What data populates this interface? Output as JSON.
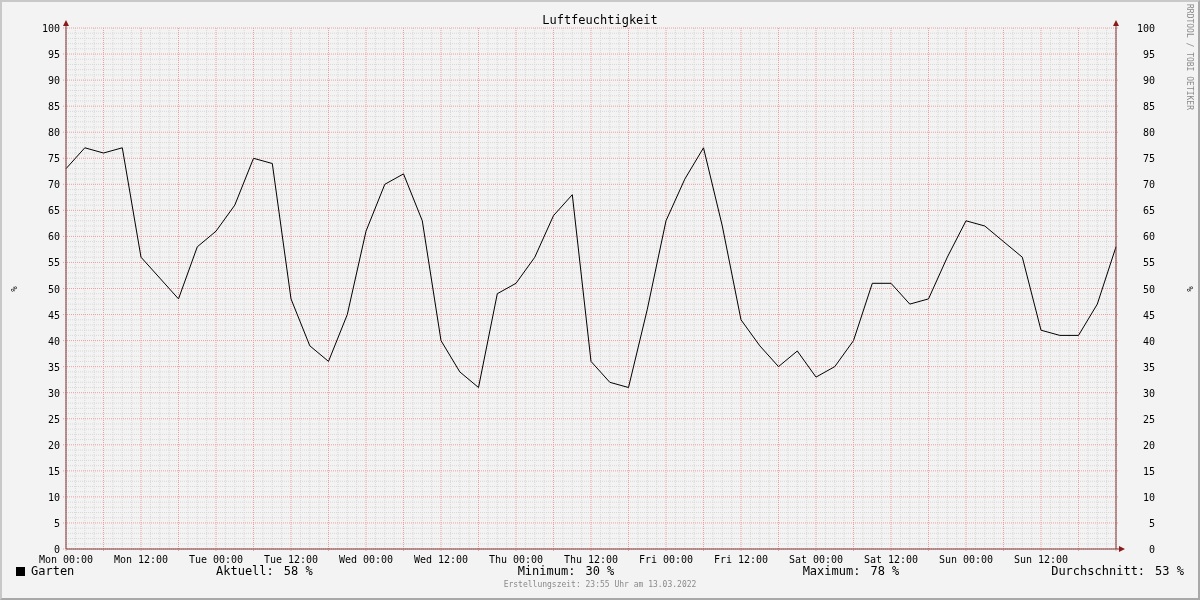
{
  "chart_data": {
    "type": "line",
    "title": "Luftfeuchtigkeit",
    "ylabel": "%",
    "categories": [
      "Mon 00:00",
      null,
      null,
      null,
      "Mon 12:00",
      null,
      null,
      null,
      "Tue 00:00",
      null,
      null,
      null,
      "Tue 12:00",
      null,
      null,
      null,
      "Wed 00:00",
      null,
      null,
      null,
      "Wed 12:00",
      null,
      null,
      null,
      "Thu 00:00",
      null,
      null,
      null,
      "Thu 12:00",
      null,
      null,
      null,
      "Fri 00:00",
      null,
      null,
      null,
      "Fri 12:00",
      null,
      null,
      null,
      "Sat 00:00",
      null,
      null,
      null,
      "Sat 12:00",
      null,
      null,
      null,
      "Sun 00:00",
      null,
      null,
      null,
      "Sun 12:00",
      null,
      null,
      null,
      null
    ],
    "series": [
      {
        "name": "Garten",
        "color": "#000000",
        "values": [
          73,
          77,
          76,
          77,
          56,
          52,
          48,
          58,
          61,
          66,
          75,
          74,
          48,
          39,
          36,
          45,
          61,
          70,
          72,
          63,
          40,
          34,
          31,
          49,
          51,
          56,
          64,
          68,
          36,
          32,
          31,
          46,
          63,
          71,
          77,
          62,
          44,
          39,
          35,
          38,
          33,
          35,
          40,
          51,
          51,
          47,
          48,
          56,
          63,
          62,
          59,
          56,
          42,
          41,
          41,
          47,
          58
        ]
      }
    ],
    "ylim": [
      0,
      100
    ],
    "grid": true,
    "yticks": [
      0,
      5,
      10,
      15,
      20,
      25,
      30,
      35,
      40,
      45,
      50,
      55,
      60,
      65,
      70,
      75,
      80,
      85,
      90,
      95,
      100
    ]
  },
  "right_axis": {
    "ylabel": "%",
    "labels": [
      "100",
      "95",
      "90",
      "85",
      "80",
      "75",
      "70",
      "65",
      "60",
      "55",
      "50",
      "45",
      "40",
      "35",
      "30",
      "25",
      "20",
      "15",
      "10",
      "5",
      "0"
    ]
  },
  "watermark_side": "RRDTOOL / TOBI OETIKER",
  "stats": [
    {
      "label": "Aktuell:",
      "value": "58 %"
    },
    {
      "label": "Minimum:",
      "value": "30 %"
    },
    {
      "label": "Maximum:",
      "value": "78 %"
    },
    {
      "label": "Durchschnitt:",
      "value": "53 %"
    }
  ],
  "footer": "Erstellungszeit: 23:55 Uhr am 13.03.2022"
}
